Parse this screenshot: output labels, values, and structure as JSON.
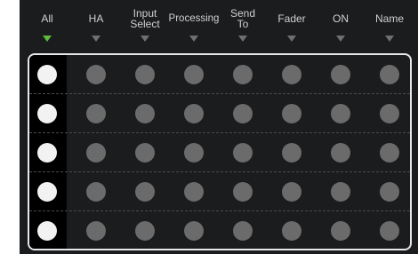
{
  "columns": [
    {
      "label": "All",
      "active": true
    },
    {
      "label": "HA",
      "active": false
    },
    {
      "label": "Input\nSelect",
      "active": false
    },
    {
      "label": "Processing",
      "active": false
    },
    {
      "label": "Send\nTo",
      "active": false
    },
    {
      "label": "Fader",
      "active": false
    },
    {
      "label": "ON",
      "active": false
    },
    {
      "label": "Name",
      "active": false
    }
  ],
  "rows": [
    {
      "states": [
        "on",
        "off",
        "off",
        "off",
        "off",
        "off",
        "off",
        "off"
      ]
    },
    {
      "states": [
        "on",
        "off",
        "off",
        "off",
        "off",
        "off",
        "off",
        "off"
      ]
    },
    {
      "states": [
        "on",
        "off",
        "off",
        "off",
        "off",
        "off",
        "off",
        "off"
      ]
    },
    {
      "states": [
        "on",
        "off",
        "off",
        "off",
        "off",
        "off",
        "off",
        "off"
      ]
    },
    {
      "states": [
        "on",
        "off",
        "off",
        "off",
        "off",
        "off",
        "off",
        "off"
      ]
    }
  ],
  "colors": {
    "active_triangle": "#5dbb3f",
    "inactive_triangle": "#6f6f6f",
    "dot_on": "#f2f2f2",
    "dot_off": "#6b6b6b"
  }
}
